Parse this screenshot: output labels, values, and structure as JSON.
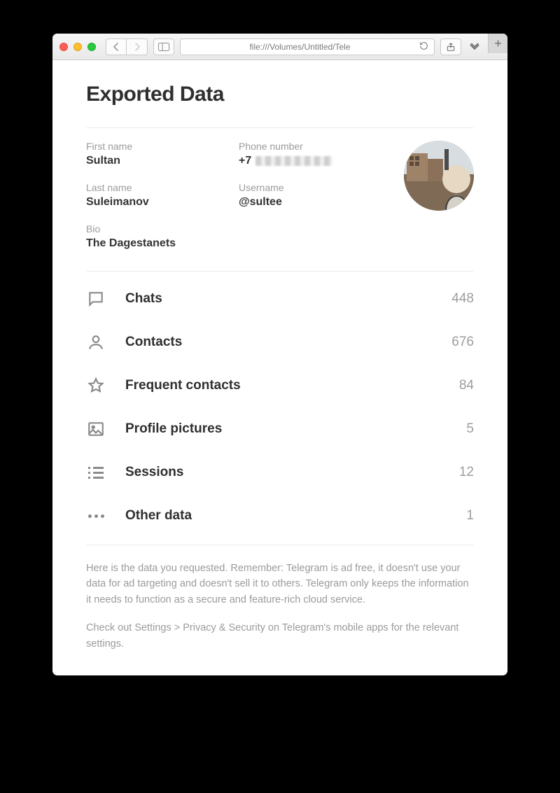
{
  "browser": {
    "address": "file:///Volumes/Untitled/Tele"
  },
  "page": {
    "title": "Exported Data"
  },
  "profile": {
    "first_name_label": "First name",
    "first_name": "Sultan",
    "last_name_label": "Last name",
    "last_name": "Suleimanov",
    "bio_label": "Bio",
    "bio": "The Dagestanets",
    "phone_label": "Phone number",
    "phone_prefix": "+7",
    "username_label": "Username",
    "username": "@sultee"
  },
  "sections": [
    {
      "icon": "chat-icon",
      "label": "Chats",
      "count": "448"
    },
    {
      "icon": "person-icon",
      "label": "Contacts",
      "count": "676"
    },
    {
      "icon": "star-icon",
      "label": "Frequent contacts",
      "count": "84"
    },
    {
      "icon": "image-icon",
      "label": "Profile pictures",
      "count": "5"
    },
    {
      "icon": "sessions-icon",
      "label": "Sessions",
      "count": "12"
    },
    {
      "icon": "more-icon",
      "label": "Other data",
      "count": "1"
    }
  ],
  "footer": {
    "p1": "Here is the data you requested. Remember: Telegram is ad free, it doesn't use your data for ad targeting and doesn't sell it to others. Telegram only keeps the information it needs to function as a secure and feature-rich cloud service.",
    "p2": "Check out Settings > Privacy & Security on Telegram's mobile apps for the relevant settings."
  }
}
